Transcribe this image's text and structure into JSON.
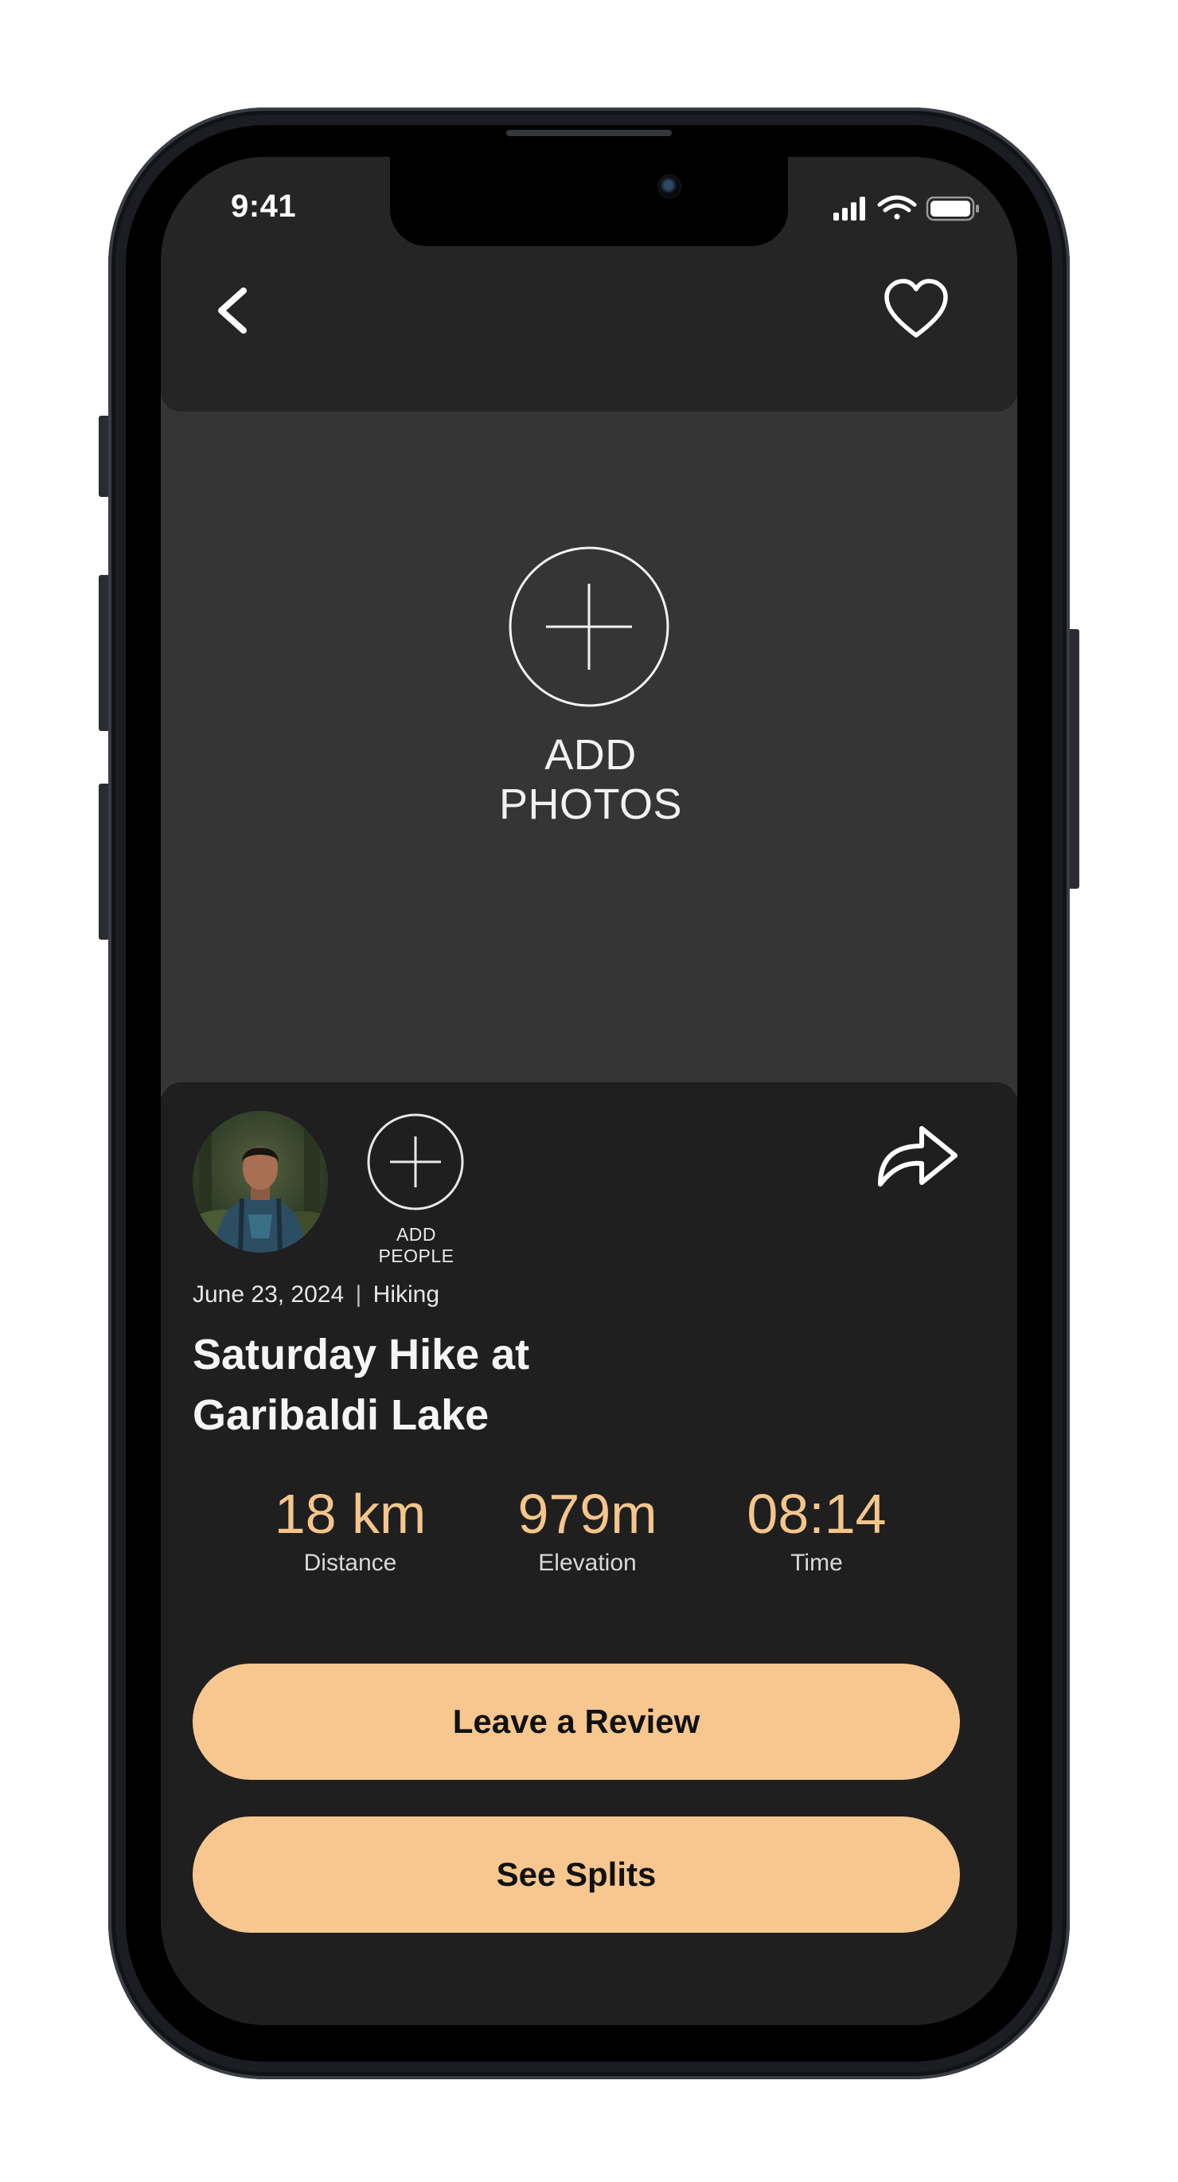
{
  "status_bar": {
    "time": "9:41"
  },
  "header": {
    "back_icon": "chevron-left-icon",
    "favorite_icon": "heart-outline-icon"
  },
  "photos": {
    "add_label": "ADD PHOTOS",
    "icon": "plus-circle-icon"
  },
  "people": {
    "add_label": "ADD PEOPLE",
    "icon": "plus-circle-icon"
  },
  "activity": {
    "date": "June 23, 2024",
    "separator": "|",
    "type": "Hiking",
    "title_line1": "Saturday Hike at",
    "title_line2": "Garibaldi Lake"
  },
  "stats": [
    {
      "value": "18 km",
      "label": "Distance"
    },
    {
      "value": "979m",
      "label": "Elevation"
    },
    {
      "value": "08:14",
      "label": "Time"
    }
  ],
  "actions": {
    "review_label": "Leave a Review",
    "splits_label": "See Splits"
  },
  "colors": {
    "accent": "#f7c78f",
    "stat_text": "#f5c58b",
    "screen_bg": "#1f1f1f",
    "photo_bg": "#353535"
  }
}
